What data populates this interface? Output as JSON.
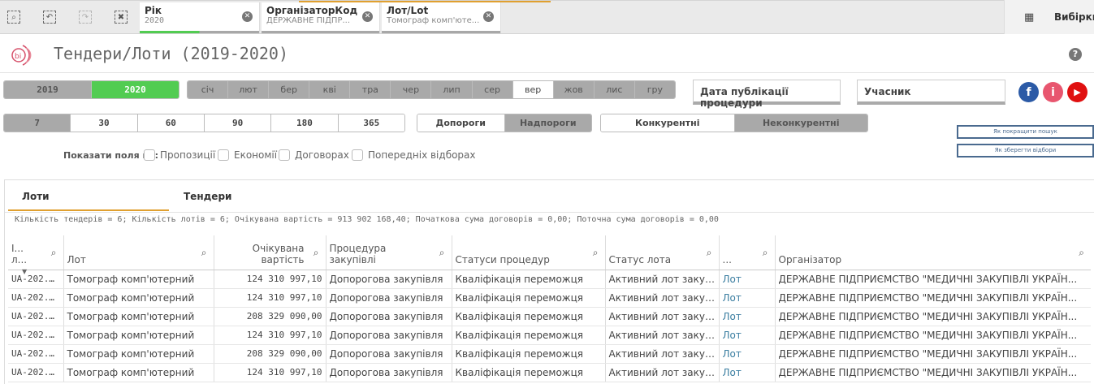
{
  "toolbar": {
    "icons": [
      "smart-search-icon",
      "step-back-icon",
      "step-forward-icon",
      "clear-selections-icon"
    ]
  },
  "filters": [
    {
      "title": "Рік",
      "value": "2020"
    },
    {
      "title": "ОрганізаторКод",
      "value": "ДЕРЖАВНЕ ПІДПР..."
    },
    {
      "title": "Лот/Lot",
      "value": "Томограф комп'юте..."
    }
  ],
  "selections_label": "Вибірки",
  "title": "Тендери/Лоти (2019-2020)",
  "years": [
    {
      "label": "2019",
      "selected": false
    },
    {
      "label": "2020",
      "selected": true
    }
  ],
  "months": [
    "січ",
    "лют",
    "бер",
    "кві",
    "тра",
    "чер",
    "лип",
    "сер",
    "вер",
    "жов",
    "лис",
    "гру"
  ],
  "months_selected": "вер",
  "days": [
    "7",
    "30",
    "60",
    "90",
    "180",
    "365"
  ],
  "days_selected": "7",
  "thresholds": [
    "Допороги",
    "Надпороги"
  ],
  "competitive": [
    "Конкурентні",
    "Неконкурентні"
  ],
  "date_box": "Дата публікації процедури",
  "participant_box": "Учасник",
  "links": [
    "Як покращити пошук",
    "Як зберегти відбори"
  ],
  "show_fields": {
    "label": "Показати поля по:",
    "options": [
      "Пропозиції",
      "Економії",
      "Договорах",
      "Попередніх відборах"
    ]
  },
  "tabs": [
    "Лоти",
    "Тендери"
  ],
  "active_tab": "Лоти",
  "summary": "Кількість тендерів = 6; Кількість лотів = 6; Очікувана вартість = 913 902 168,40; Початкова сума договорів = 0,00; Поточна сума договорів = 0,00",
  "table": {
    "headers": [
      "І... л...",
      "Лот",
      "Очікувана вартість",
      "Процедура закупівлі",
      "Статуси процедур",
      "Статус лота",
      "...",
      "Організатор"
    ],
    "rows": [
      [
        "UA-202...",
        "Томограф комп'ютерний",
        "124 310 997,10",
        "Допорогова закупівля",
        "Кваліфікація переможця",
        "Активний лот закуп...",
        "Лот",
        "ДЕРЖАВНЕ ПІДПРИЄМСТВО \"МЕДИЧНІ ЗАКУПІВЛІ УКРАЇН..."
      ],
      [
        "UA-202...",
        "Томограф комп'ютерний",
        "124 310 997,10",
        "Допорогова закупівля",
        "Кваліфікація переможця",
        "Активний лот закуп...",
        "Лот",
        "ДЕРЖАВНЕ ПІДПРИЄМСТВО \"МЕДИЧНІ ЗАКУПІВЛІ УКРАЇН..."
      ],
      [
        "UA-202...",
        "Томограф комп'ютерний",
        "208 329 090,00",
        "Допорогова закупівля",
        "Кваліфікація переможця",
        "Активний лот закуп...",
        "Лот",
        "ДЕРЖАВНЕ ПІДПРИЄМСТВО \"МЕДИЧНІ ЗАКУПІВЛІ УКРАЇН..."
      ],
      [
        "UA-202...",
        "Томограф комп'ютерний",
        "124 310 997,10",
        "Допорогова закупівля",
        "Кваліфікація переможця",
        "Активний лот закуп...",
        "Лот",
        "ДЕРЖАВНЕ ПІДПРИЄМСТВО \"МЕДИЧНІ ЗАКУПІВЛІ УКРАЇН..."
      ],
      [
        "UA-202...",
        "Томограф комп'ютерний",
        "208 329 090,00",
        "Допорогова закупівля",
        "Кваліфікація переможця",
        "Активний лот закуп...",
        "Лот",
        "ДЕРЖАВНЕ ПІДПРИЄМСТВО \"МЕДИЧНІ ЗАКУПІВЛІ УКРАЇН..."
      ],
      [
        "UA-202...",
        "Томограф комп'ютерний",
        "124 310 997,10",
        "Допорогова закупівля",
        "Кваліфікація переможця",
        "Активний лот закуп...",
        "Лот",
        "ДЕРЖАВНЕ ПІДПРИЄМСТВО \"МЕДИЧНІ ЗАКУПІВЛІ УКРАЇН..."
      ]
    ]
  },
  "colors": {
    "selected": "#52cc52",
    "excluded": "#a9a9a9",
    "accent_tab": "#e0a030",
    "facebook": "#2b5aa6",
    "info": "#e8566f",
    "youtube": "#e01010"
  }
}
